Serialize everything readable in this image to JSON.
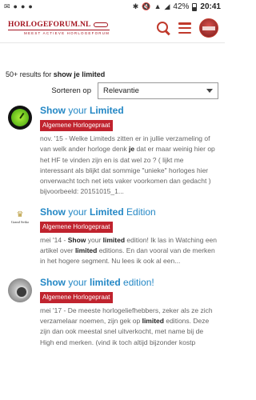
{
  "statusbar": {
    "left_icons": [
      "✉",
      "●",
      "●",
      "●"
    ],
    "right_icons": [
      "✱",
      "🔇",
      "▲",
      "◢"
    ],
    "battery": "42%",
    "time": "20:41"
  },
  "header": {
    "logo_text": "HORLOGEFORUM.NL",
    "logo_subtext": "MEEST ACTIEVE HORLOGEFORUM",
    "accent": "#c0392b"
  },
  "search": {
    "results_prefix": "50+ results for ",
    "query": "show je limited"
  },
  "sort": {
    "label": "Sorteren op",
    "selected": "Relevantie"
  },
  "results": [
    {
      "thumb": "green-watch-icon",
      "title_1": "Show",
      "title_2": " your ",
      "title_3": "Limited",
      "title_4": "",
      "title_5": "",
      "category": "Algemene Horlogepraat",
      "ex_1": "nov. '15 - Welke Limiteds zitten er in jullie verzameling of van welk ander horloge denk ",
      "ex_2": "je",
      "ex_3": " dat er maar weinig hier op het HF te vinden zijn en is dat wel zo ? ( lijkt me interessant als blijkt dat sommige \"unieke\" horloges hier onverwacht toch net iets vaker voorkomen dan gedacht ) bijvoorbeeld: 20151015_1...",
      "ex_4": "",
      "ex_5": "",
      "ex_6": "",
      "ex_7": ""
    },
    {
      "thumb": "grand-seiko-logo",
      "logo_text": "Grand Seiko",
      "title_1": "Show",
      "title_2": " your ",
      "title_3": "Limited",
      "title_4": " Edition",
      "title_5": "",
      "category": "Algemene Horlogepraat",
      "ex_1": "mei '14 - ",
      "ex_2": "Show",
      "ex_3": " your ",
      "ex_4": "limited",
      "ex_5": " edition! Ik las in Watching een artikel over ",
      "ex_6": "limited",
      "ex_7": " editions. En dan vooral van de merken in het hogere segment. Nu lees ik ook al een..."
    },
    {
      "thumb": "gear-icon",
      "title_1": "Show",
      "title_2": " your ",
      "title_3": "limited",
      "title_4": " edition!",
      "title_5": "",
      "category": "Algemene Horlogepraat",
      "ex_1": "mei '17 - De meeste horlogeliefhebbers, zeker als ze zich verzamelaar noemen, zijn gek op ",
      "ex_2": "limited",
      "ex_3": " editions. Deze zijn dan ook meestal snel uitverkocht, met name bij de High end merken. (vind ik toch altijd bijzonder kostp",
      "ex_4": "",
      "ex_5": "",
      "ex_6": "",
      "ex_7": ""
    }
  ]
}
